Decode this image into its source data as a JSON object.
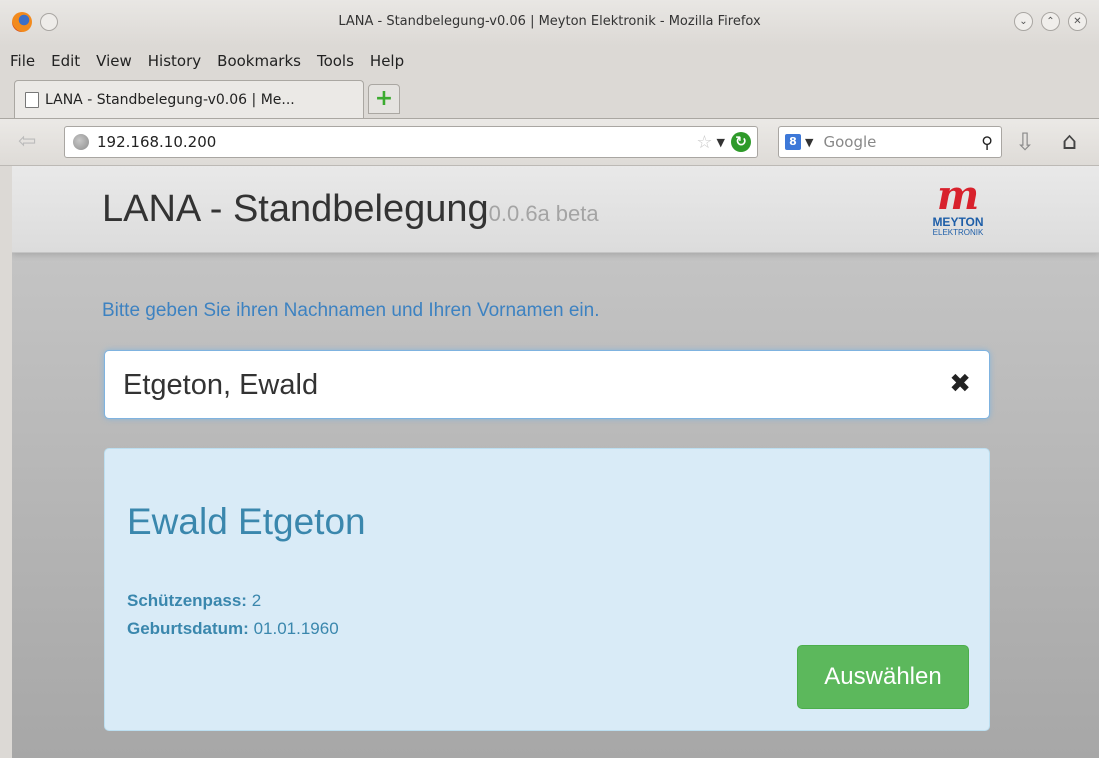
{
  "window": {
    "title": "LANA - Standbelegung-v0.06 | Meyton Elektronik - Mozilla Firefox",
    "controls": [
      "⌄",
      "⌃",
      "✕"
    ]
  },
  "menubar": {
    "items": [
      "File",
      "Edit",
      "View",
      "History",
      "Bookmarks",
      "Tools",
      "Help"
    ]
  },
  "tabs": [
    {
      "label": "LANA - Standbelegung-v0.06 | Me..."
    }
  ],
  "newtab_label": "+",
  "navbar": {
    "url": "192.168.10.200",
    "search_placeholder": "Google"
  },
  "page": {
    "title": "LANA - Standbelegung",
    "version": "0.0.6a",
    "beta": "beta",
    "brand": {
      "mark": "m",
      "name": "MEYTON",
      "sub": "ELEKTRONIK"
    },
    "instruction": "Bitte geben Sie ihren Nachnamen und Ihren Vornamen ein.",
    "name_input_value": "Etgeton, Ewald",
    "clear_symbol": "✖",
    "result": {
      "name": "Ewald Etgeton",
      "pass_label": "Schützenpass:",
      "pass_value": "2",
      "birth_label": "Geburtsdatum:",
      "birth_value": "01.01.1960",
      "select_label": "Auswählen"
    }
  },
  "colors": {
    "link_blue": "#3d82c1",
    "info_blue": "#3a87ad",
    "card_bg": "#d9ebf7",
    "button_green": "#5cb85c",
    "brand_red": "#d8212c",
    "brand_blue": "#1e5ea8"
  }
}
